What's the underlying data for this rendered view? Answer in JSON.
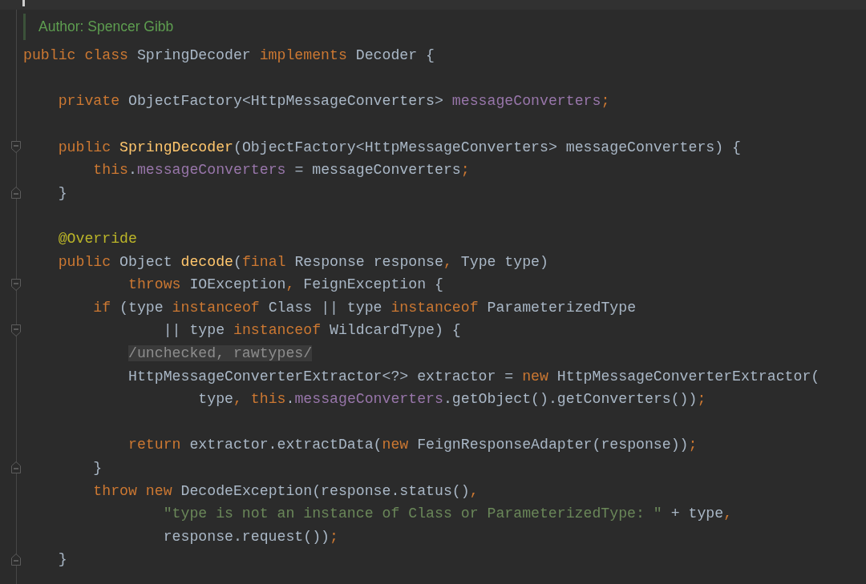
{
  "editor": {
    "doc_comment": {
      "text": "Author: Spencer Gibb"
    },
    "lines": [
      {
        "kind": "code",
        "tokens": [
          {
            "text": "public class ",
            "kind": "keyword"
          },
          {
            "text": "SpringDecoder ",
            "kind": "plain"
          },
          {
            "text": "implements ",
            "kind": "keyword"
          },
          {
            "text": "Decoder {",
            "kind": "plain"
          }
        ]
      },
      {
        "kind": "blank"
      },
      {
        "kind": "code",
        "tokens": [
          {
            "text": "    private ",
            "kind": "keyword"
          },
          {
            "text": "ObjectFactory<HttpMessageConverters> ",
            "kind": "plain"
          },
          {
            "text": "messageConverters",
            "kind": "field"
          },
          {
            "text": ";",
            "kind": "keyword"
          }
        ]
      },
      {
        "kind": "blank"
      },
      {
        "kind": "code",
        "fold_marker": {
          "kind": "start"
        },
        "tokens": [
          {
            "text": "    public ",
            "kind": "keyword"
          },
          {
            "text": "SpringDecoder",
            "kind": "method"
          },
          {
            "text": "(ObjectFactory<HttpMessageConverters> messageConverters) {",
            "kind": "plain"
          }
        ]
      },
      {
        "kind": "code",
        "tokens": [
          {
            "text": "        this",
            "kind": "keyword"
          },
          {
            "text": ".",
            "kind": "plain"
          },
          {
            "text": "messageConverters",
            "kind": "field"
          },
          {
            "text": " = messageConverters",
            "kind": "plain"
          },
          {
            "text": ";",
            "kind": "keyword"
          }
        ]
      },
      {
        "kind": "code",
        "fold_marker": {
          "kind": "end"
        },
        "tokens": [
          {
            "text": "    }",
            "kind": "plain"
          }
        ]
      },
      {
        "kind": "blank"
      },
      {
        "kind": "code",
        "tokens": [
          {
            "text": "    @Override",
            "kind": "annotation"
          }
        ]
      },
      {
        "kind": "code",
        "tokens": [
          {
            "text": "    public ",
            "kind": "keyword"
          },
          {
            "text": "Object ",
            "kind": "plain"
          },
          {
            "text": "decode",
            "kind": "method"
          },
          {
            "text": "(",
            "kind": "plain"
          },
          {
            "text": "final ",
            "kind": "keyword"
          },
          {
            "text": "Response response",
            "kind": "plain"
          },
          {
            "text": ", ",
            "kind": "keyword"
          },
          {
            "text": "Type type)",
            "kind": "plain"
          }
        ]
      },
      {
        "kind": "code",
        "fold_marker": {
          "kind": "start"
        },
        "tokens": [
          {
            "text": "            throws ",
            "kind": "keyword"
          },
          {
            "text": "IOException",
            "kind": "plain"
          },
          {
            "text": ", ",
            "kind": "keyword"
          },
          {
            "text": "FeignException {",
            "kind": "plain"
          }
        ]
      },
      {
        "kind": "code",
        "tokens": [
          {
            "text": "        if ",
            "kind": "keyword"
          },
          {
            "text": "(type ",
            "kind": "plain"
          },
          {
            "text": "instanceof ",
            "kind": "keyword"
          },
          {
            "text": "Class || type ",
            "kind": "plain"
          },
          {
            "text": "instanceof ",
            "kind": "keyword"
          },
          {
            "text": "ParameterizedType",
            "kind": "plain"
          }
        ]
      },
      {
        "kind": "code",
        "fold_marker": {
          "kind": "start"
        },
        "tokens": [
          {
            "text": "                || type ",
            "kind": "plain"
          },
          {
            "text": "instanceof ",
            "kind": "keyword"
          },
          {
            "text": "WildcardType) {",
            "kind": "plain"
          }
        ]
      },
      {
        "kind": "code",
        "tokens": [
          {
            "text": "            /unchecked, rawtypes/",
            "kind": "folded"
          }
        ]
      },
      {
        "kind": "code",
        "tokens": [
          {
            "text": "            HttpMessageConverterExtractor<?> extractor = ",
            "kind": "plain"
          },
          {
            "text": "new ",
            "kind": "keyword"
          },
          {
            "text": "HttpMessageConverterExtractor(",
            "kind": "plain"
          }
        ]
      },
      {
        "kind": "code",
        "tokens": [
          {
            "text": "                    type",
            "kind": "plain"
          },
          {
            "text": ", this",
            "kind": "keyword"
          },
          {
            "text": ".",
            "kind": "plain"
          },
          {
            "text": "messageConverters",
            "kind": "field"
          },
          {
            "text": ".getObject().getConverters())",
            "kind": "plain"
          },
          {
            "text": ";",
            "kind": "keyword"
          }
        ]
      },
      {
        "kind": "blank"
      },
      {
        "kind": "code",
        "tokens": [
          {
            "text": "            return ",
            "kind": "keyword"
          },
          {
            "text": "extractor.extractData(",
            "kind": "plain"
          },
          {
            "text": "new ",
            "kind": "keyword"
          },
          {
            "text": "FeignResponseAdapter(response))",
            "kind": "plain"
          },
          {
            "text": ";",
            "kind": "keyword"
          }
        ]
      },
      {
        "kind": "code",
        "fold_marker": {
          "kind": "end"
        },
        "tokens": [
          {
            "text": "        }",
            "kind": "plain"
          }
        ]
      },
      {
        "kind": "code",
        "tokens": [
          {
            "text": "        throw new ",
            "kind": "keyword"
          },
          {
            "text": "DecodeException(response.status()",
            "kind": "plain"
          },
          {
            "text": ",",
            "kind": "keyword"
          }
        ]
      },
      {
        "kind": "code",
        "tokens": [
          {
            "text": "                \"type is not an instance of Class or ParameterizedType: \"",
            "kind": "string"
          },
          {
            "text": " + type",
            "kind": "plain"
          },
          {
            "text": ",",
            "kind": "keyword"
          }
        ]
      },
      {
        "kind": "code",
        "tokens": [
          {
            "text": "                response.request())",
            "kind": "plain"
          },
          {
            "text": ";",
            "kind": "keyword"
          }
        ]
      },
      {
        "kind": "code",
        "fold_marker": {
          "kind": "end"
        },
        "tokens": [
          {
            "text": "    }",
            "kind": "plain"
          }
        ]
      }
    ]
  }
}
